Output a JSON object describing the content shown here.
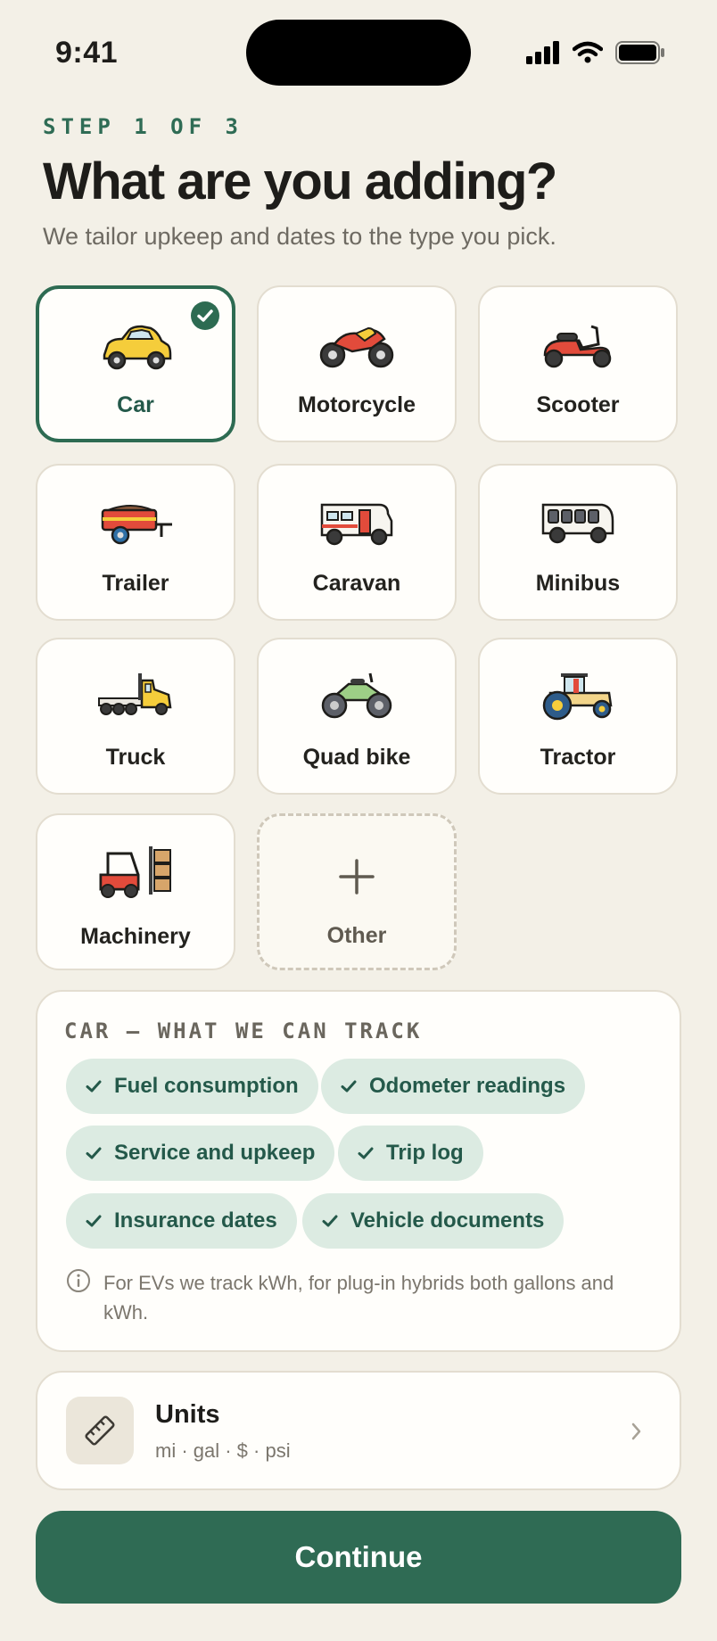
{
  "status_bar": {
    "time": "9:41"
  },
  "header": {
    "step": "STEP 1 OF 3",
    "title": "What are you adding?",
    "subtitle": "We tailor upkeep and dates to the type you pick."
  },
  "vehicle_types": [
    {
      "label": "Car",
      "icon": "car-icon",
      "selected": true
    },
    {
      "label": "Motorcycle",
      "icon": "motorcycle-icon",
      "selected": false
    },
    {
      "label": "Scooter",
      "icon": "scooter-icon",
      "selected": false
    },
    {
      "label": "Trailer",
      "icon": "trailer-icon",
      "selected": false
    },
    {
      "label": "Caravan",
      "icon": "caravan-icon",
      "selected": false
    },
    {
      "label": "Minibus",
      "icon": "minibus-icon",
      "selected": false
    },
    {
      "label": "Truck",
      "icon": "truck-icon",
      "selected": false
    },
    {
      "label": "Quad bike",
      "icon": "quad-bike-icon",
      "selected": false
    },
    {
      "label": "Tractor",
      "icon": "tractor-icon",
      "selected": false
    },
    {
      "label": "Machinery",
      "icon": "forklift-icon",
      "selected": false
    },
    {
      "label": "Other",
      "icon": "plus-icon",
      "selected": false
    }
  ],
  "track": {
    "heading": "CAR — WHAT WE CAN TRACK",
    "chips": [
      "Fuel consumption",
      "Odometer readings",
      "Service and upkeep",
      "Trip log",
      "Insurance dates",
      "Vehicle documents"
    ],
    "note": "For EVs we track kWh, for plug-in hybrids both gallons and kWh."
  },
  "units": {
    "title": "Units",
    "summary": "mi · gal · $ · psi"
  },
  "continue_label": "Continue",
  "colors": {
    "accent": "#2f6b54",
    "chip_bg": "#dcebe2",
    "background": "#f3f0e7"
  }
}
